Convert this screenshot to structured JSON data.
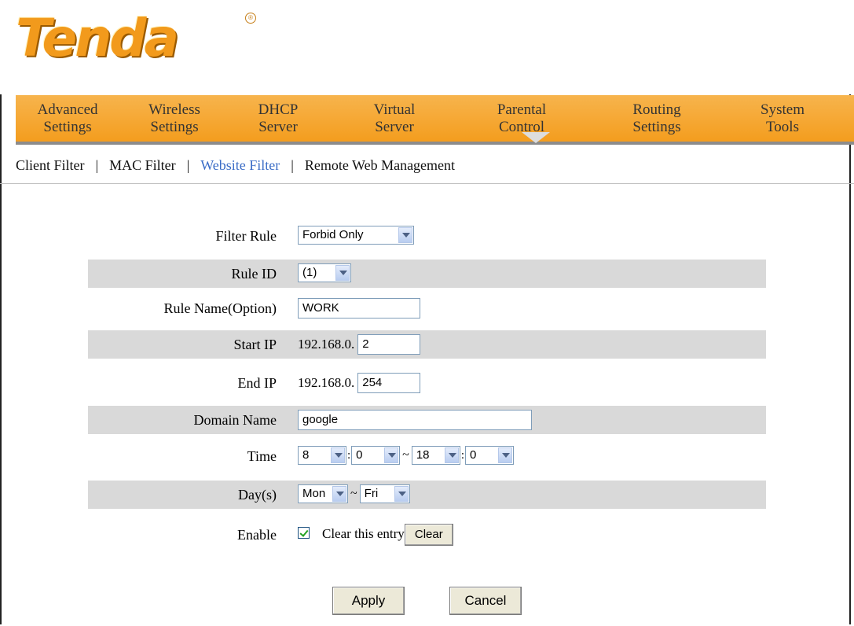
{
  "brand": {
    "logo_text": "Tenda",
    "registered_mark": "®"
  },
  "nav": {
    "items": [
      {
        "label": "Advanced\nSettings"
      },
      {
        "label": "Wireless\nSettings"
      },
      {
        "label": "DHCP\nServer"
      },
      {
        "label": "Virtual\nServer"
      },
      {
        "label": "Parental\nControl"
      },
      {
        "label": "Routing\nSettings"
      },
      {
        "label": "System\nTools"
      }
    ],
    "active": "Parental Control"
  },
  "subnav": {
    "items": [
      "Client Filter",
      "MAC Filter",
      "Website Filter",
      "Remote Web Management"
    ],
    "separator": "|",
    "active": "Website Filter"
  },
  "form": {
    "filter_rule": {
      "label": "Filter Rule",
      "value": "Forbid Only"
    },
    "rule_id": {
      "label": "Rule ID",
      "value": "(1)"
    },
    "rule_name": {
      "label": "Rule Name(Option)",
      "value": "WORK"
    },
    "start_ip": {
      "label": "Start IP",
      "prefix": "192.168.0.",
      "value": "2"
    },
    "end_ip": {
      "label": "End IP",
      "prefix": "192.168.0.",
      "value": "254"
    },
    "domain_name": {
      "label": "Domain Name",
      "value": "google"
    },
    "time": {
      "label": "Time",
      "start_hour": "8",
      "start_min": "0",
      "end_hour": "18",
      "end_min": "0",
      "range_sep": "~",
      "colon": ":"
    },
    "days": {
      "label": "Day(s)",
      "start": "Mon",
      "end": "Fri",
      "range_sep": "~"
    },
    "enable": {
      "label": "Enable",
      "checked": true,
      "clear_text": "Clear this entry",
      "clear_button": "Clear"
    }
  },
  "actions": {
    "apply": "Apply",
    "cancel": "Cancel"
  },
  "colors": {
    "nav_bg": "#f49d1e",
    "logo": "#f29a1c",
    "active_link": "#3a6cc6",
    "row_shade": "#d9d9d9"
  }
}
